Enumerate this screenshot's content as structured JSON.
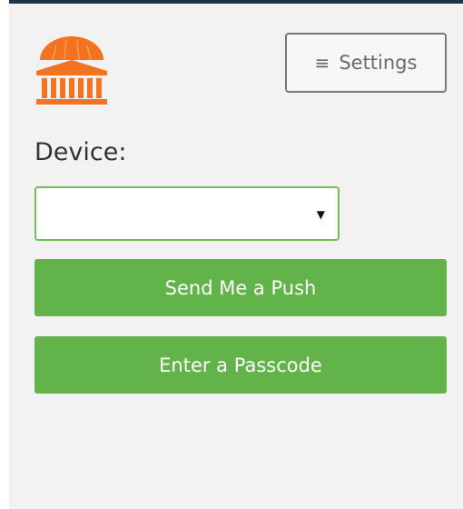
{
  "header": {
    "logo_icon": "rotunda-logo-icon",
    "settings": {
      "icon": "hamburger-menu-icon",
      "glyph": "≡",
      "label": "Settings"
    }
  },
  "device": {
    "label": "Device:",
    "selected": "",
    "caret": "▼"
  },
  "actions": {
    "push_label": "Send Me a Push",
    "passcode_label": "Enter a Passcode"
  },
  "colors": {
    "accent_green": "#62b44a",
    "logo_orange": "#f47321",
    "top_border": "#1f3349"
  }
}
